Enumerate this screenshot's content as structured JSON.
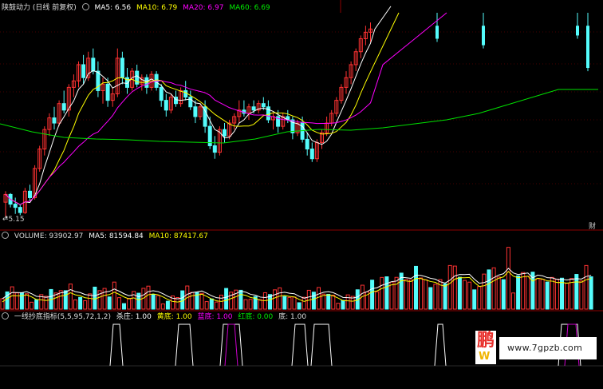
{
  "colors": {
    "up": "#ff3232",
    "down": "#54fcfc",
    "ma5": "#ffffff",
    "ma10": "#ffff00",
    "ma20": "#ff00ff",
    "ma60": "#00e000",
    "grid": "#8b0000"
  },
  "price_panel": {
    "title": "陕鼓动力 (日线 前复权)",
    "ma5_label": "MA5: 6.56",
    "ma10_label": "MA10: 6.79",
    "ma20_label": "MA20: 6.97",
    "ma60_label": "MA60: 6.69",
    "low_marker": "←5.15",
    "tag": "财"
  },
  "volume_panel": {
    "volume_label": "VOLUME: 93902.97",
    "ma5_label": "MA5: 81594.84",
    "ma10_label": "MA10: 87417.67"
  },
  "indicator_panel": {
    "name": "一线抄底指标(5,5,95,72,1,2)",
    "kill_label": "杀庄: 1.00",
    "yellow_label": "黄底: 1.00",
    "blue_label": "蓝底: 1.00",
    "red_label": "红底: 0.00",
    "bottom_label": "底: 1.00"
  },
  "watermark": {
    "logo_char1": "鹏",
    "logo_char2": "W",
    "url": "www.7gpzb.com"
  },
  "chart_data": [
    {
      "type": "candlestick",
      "name": "price",
      "y_range": [
        5.0,
        8.3
      ],
      "candles": [
        [
          5.38,
          5.55,
          5.15,
          5.5
        ],
        [
          5.5,
          5.52,
          5.3,
          5.35
        ],
        [
          5.35,
          5.45,
          5.2,
          5.3
        ],
        [
          5.3,
          5.35,
          5.18,
          5.22
        ],
        [
          5.22,
          5.6,
          5.2,
          5.55
        ],
        [
          5.55,
          5.65,
          5.4,
          5.45
        ],
        [
          5.45,
          5.95,
          5.42,
          5.9
        ],
        [
          5.9,
          6.25,
          5.85,
          6.2
        ],
        [
          6.2,
          6.55,
          6.1,
          6.5
        ],
        [
          6.5,
          6.75,
          6.4,
          6.68
        ],
        [
          6.68,
          6.85,
          6.5,
          6.6
        ],
        [
          6.6,
          6.95,
          6.55,
          6.9
        ],
        [
          6.9,
          7.1,
          6.75,
          6.8
        ],
        [
          6.8,
          7.2,
          6.7,
          7.15
        ],
        [
          7.15,
          7.35,
          7.0,
          7.25
        ],
        [
          7.25,
          7.55,
          7.15,
          7.5
        ],
        [
          7.5,
          7.65,
          7.2,
          7.3
        ],
        [
          7.3,
          7.7,
          7.25,
          7.6
        ],
        [
          7.6,
          7.75,
          7.35,
          7.4
        ],
        [
          7.4,
          7.55,
          7.0,
          7.1
        ],
        [
          7.1,
          7.3,
          6.9,
          7.2
        ],
        [
          7.2,
          7.3,
          6.85,
          6.95
        ],
        [
          6.95,
          7.15,
          6.85,
          7.05
        ],
        [
          7.05,
          7.75,
          7.0,
          7.6
        ],
        [
          7.6,
          7.7,
          7.2,
          7.3
        ],
        [
          7.3,
          7.45,
          7.05,
          7.15
        ],
        [
          7.15,
          7.45,
          7.1,
          7.4
        ],
        [
          7.4,
          7.5,
          7.15,
          7.2
        ],
        [
          7.2,
          7.35,
          7.1,
          7.3
        ],
        [
          7.3,
          7.35,
          7.05,
          7.15
        ],
        [
          7.15,
          7.4,
          7.1,
          7.35
        ],
        [
          7.35,
          7.4,
          7.1,
          7.15
        ],
        [
          7.15,
          7.2,
          6.85,
          6.95
        ],
        [
          6.95,
          7.05,
          6.7,
          6.8
        ],
        [
          6.8,
          7.05,
          6.75,
          7.0
        ],
        [
          7.0,
          7.1,
          6.85,
          6.9
        ],
        [
          6.9,
          7.15,
          6.85,
          7.1
        ],
        [
          7.1,
          7.25,
          6.95,
          7.0
        ],
        [
          7.0,
          7.1,
          6.8,
          6.85
        ],
        [
          6.85,
          6.95,
          6.6,
          6.7
        ],
        [
          6.7,
          6.9,
          6.65,
          6.85
        ],
        [
          6.85,
          6.95,
          6.45,
          6.55
        ],
        [
          6.55,
          6.7,
          6.2,
          6.25
        ],
        [
          6.25,
          6.4,
          6.05,
          6.15
        ],
        [
          6.15,
          6.55,
          6.1,
          6.5
        ],
        [
          6.5,
          6.6,
          6.3,
          6.4
        ],
        [
          6.4,
          6.65,
          6.35,
          6.6
        ],
        [
          6.6,
          6.75,
          6.5,
          6.7
        ],
        [
          6.7,
          6.95,
          6.6,
          6.8
        ],
        [
          6.8,
          6.95,
          6.7,
          6.75
        ],
        [
          6.75,
          6.9,
          6.65,
          6.85
        ],
        [
          6.85,
          6.95,
          6.75,
          6.8
        ],
        [
          6.8,
          6.95,
          6.75,
          6.9
        ],
        [
          6.9,
          7.0,
          6.8,
          6.85
        ],
        [
          6.85,
          6.95,
          6.6,
          6.65
        ],
        [
          6.65,
          6.75,
          6.5,
          6.7
        ],
        [
          6.7,
          6.8,
          6.45,
          6.55
        ],
        [
          6.55,
          6.75,
          6.5,
          6.7
        ],
        [
          6.7,
          6.8,
          6.6,
          6.65
        ],
        [
          6.65,
          6.7,
          6.35,
          6.45
        ],
        [
          6.45,
          6.65,
          6.4,
          6.6
        ],
        [
          6.6,
          6.7,
          6.3,
          6.35
        ],
        [
          6.35,
          6.45,
          6.1,
          6.2
        ],
        [
          6.2,
          6.3,
          6.0,
          6.05
        ],
        [
          6.05,
          6.35,
          6.0,
          6.3
        ],
        [
          6.3,
          6.5,
          6.2,
          6.45
        ],
        [
          6.45,
          6.7,
          6.4,
          6.6
        ],
        [
          6.6,
          6.8,
          6.55,
          6.75
        ],
        [
          6.75,
          7.0,
          6.7,
          6.95
        ],
        [
          6.95,
          7.2,
          6.9,
          7.15
        ],
        [
          7.15,
          7.4,
          7.05,
          7.3
        ],
        [
          7.3,
          7.55,
          7.2,
          7.5
        ],
        [
          7.5,
          7.75,
          7.4,
          7.7
        ],
        [
          7.7,
          7.95,
          7.6,
          7.9
        ],
        [
          7.9,
          8.1,
          7.8,
          8.0
        ],
        [
          8.0,
          8.15,
          7.85,
          8.05
        ]
      ],
      "late_candles": [
        [
          8.1,
          8.3,
          7.85,
          7.9
        ],
        [
          8.1,
          8.3,
          7.75,
          7.8
        ],
        [
          8.1,
          8.3,
          7.9,
          7.95
        ],
        [
          8.1,
          8.3,
          7.4,
          7.45
        ]
      ]
    },
    {
      "type": "bar",
      "name": "volume",
      "y_range": [
        0,
        180000
      ]
    },
    {
      "type": "line",
      "name": "indicator",
      "y_range": [
        0,
        1
      ]
    }
  ]
}
